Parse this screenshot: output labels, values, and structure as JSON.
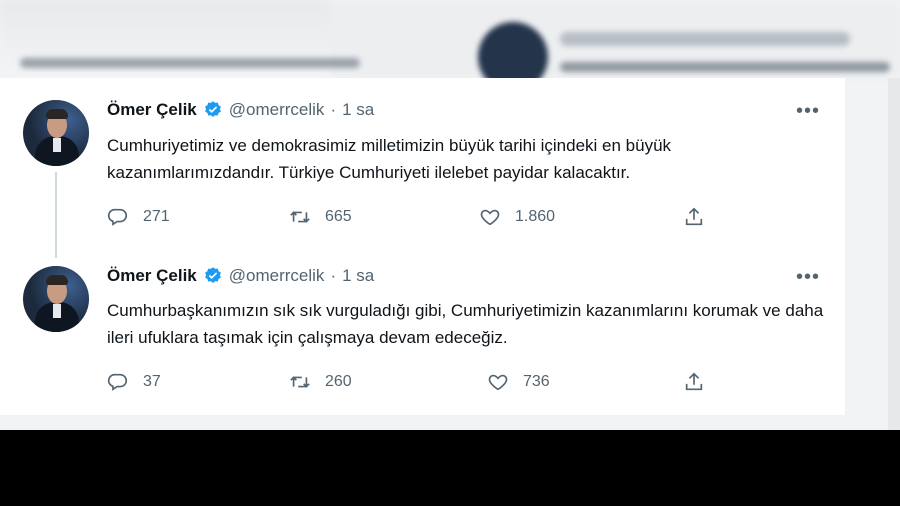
{
  "tweets": [
    {
      "author": {
        "name": "Ömer Çelik",
        "handle": "@omerrcelik"
      },
      "separator": "·",
      "time": "1 sa",
      "text": "Cumhuriyetimiz ve demokrasimiz milletimizin büyük tarihi içindeki en büyük kazanımlarımızdandır. Türkiye Cumhuriyeti ilelebet payidar kalacaktır.",
      "replies": "271",
      "retweets": "665",
      "likes": "1.860"
    },
    {
      "author": {
        "name": "Ömer Çelik",
        "handle": "@omerrcelik"
      },
      "separator": "·",
      "time": "1 sa",
      "text": "Cumhurbaşkanımızın sık sık vurguladığı gibi, Cumhuriyetimizin kazanımlarını korumak ve daha ileri ufuklara taşımak için çalışmaya devam edeceğiz.",
      "replies": "37",
      "retweets": "260",
      "likes": "736"
    }
  ],
  "icons": {
    "more": "more-horizontal-icon",
    "reply": "reply-icon",
    "retweet": "retweet-icon",
    "like": "heart-icon",
    "share": "share-icon",
    "verified": "verified-badge-icon"
  },
  "colors": {
    "text": "#0f1419",
    "secondary": "#536471",
    "verified": "#1d9bf0",
    "thread_line": "#cfd9de"
  }
}
